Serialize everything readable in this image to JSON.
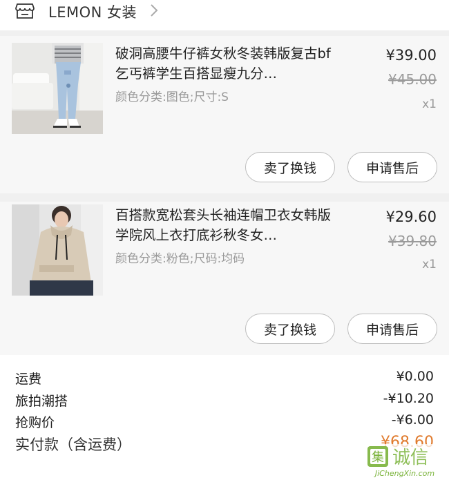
{
  "store": {
    "name": "LEMON 女装",
    "icon": "store-icon"
  },
  "items": [
    {
      "title": "破洞高腰牛仔裤女秋冬装韩版复古bf乞丐裤学生百搭显瘦九分…",
      "sku": "颜色分类:图色;尺寸:S",
      "price": "¥39.00",
      "original_price": "¥45.00",
      "qty": "x1",
      "buttons": [
        "卖了换钱",
        "申请售后"
      ]
    },
    {
      "title": "百搭款宽松套头长袖连帽卫衣女韩版学院风上衣打底衫秋冬女…",
      "sku": "颜色分类:粉色;尺码:均码",
      "price": "¥29.60",
      "original_price": "¥39.80",
      "qty": "x1",
      "buttons": [
        "卖了换钱",
        "申请售后"
      ]
    }
  ],
  "summary": {
    "shipping_label": "运费",
    "shipping_value": "¥0.00",
    "discount1_label": "旅拍潮搭",
    "discount1_value": "-¥10.20",
    "discount2_label": "抢购价",
    "discount2_value": "-¥6.00",
    "total_label": "实付款（含运费）",
    "total_value": "¥68.60"
  },
  "watermark": {
    "text": "JiChengXin.com",
    "glyphs": "集诚信"
  },
  "colors": {
    "accent": "#e07a2c",
    "muted": "#9a9a9a",
    "gap": "#f0f0f0",
    "card": "#f7f7f7"
  }
}
